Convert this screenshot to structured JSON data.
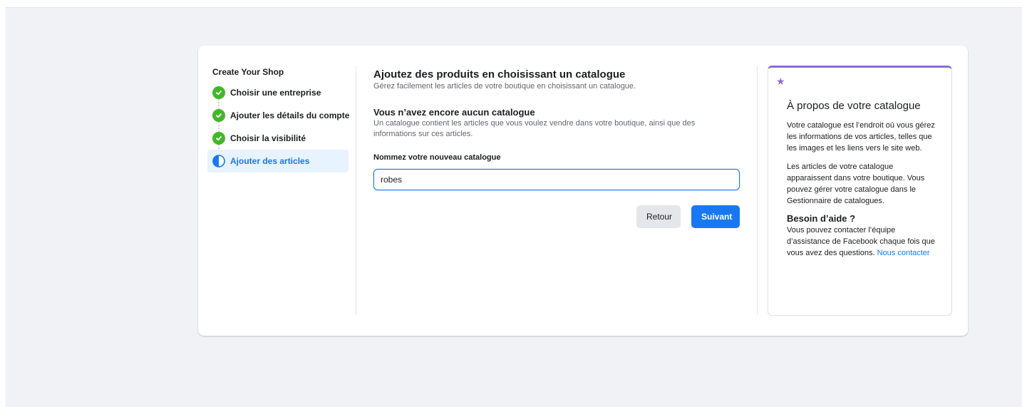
{
  "stepper": {
    "title": "Create Your Shop",
    "steps": [
      {
        "label": "Choisir une entreprise",
        "status": "done"
      },
      {
        "label": "Ajouter les détails du compte",
        "status": "done"
      },
      {
        "label": "Choisir la visibilité",
        "status": "done"
      },
      {
        "label": "Ajouter des articles",
        "status": "active"
      }
    ]
  },
  "main": {
    "title": "Ajoutez des produits en choisissant un catalogue",
    "subtitle": "Gérez facilement les articles de votre boutique en choisissant un catalogue.",
    "section_title": "Vous n’avez encore aucun catalogue",
    "section_text": "Un catalogue contient les articles que vous voulez vendre dans votre boutique, ainsi que des informations sur ces articles.",
    "field_label": "Nommez votre nouveau catalogue",
    "input_value": "robes",
    "back_label": "Retour",
    "next_label": "Suivant"
  },
  "info": {
    "title": "À propos de votre catalogue",
    "p1": "Votre catalogue est l’endroit où vous gérez les informations de vos articles, telles que les images et les liens vers le site web.",
    "p2": "Les articles de votre catalogue apparaissent dans votre boutique. Vous pouvez gérer votre catalogue dans le Gestionnaire de catalogues.",
    "help_title": "Besoin d’aide ?",
    "help_text": "Vous pouvez contacter l’équipe d’assistance de Facebook chaque fois que vous avez des questions.",
    "help_link": "Nous contacter"
  },
  "colors": {
    "primary": "#1877f2",
    "success": "#42b72a",
    "accent": "#8c6cd0"
  },
  "icons": {
    "done": "check-circle-icon",
    "active": "half-circle-icon",
    "info": "star-icon"
  }
}
